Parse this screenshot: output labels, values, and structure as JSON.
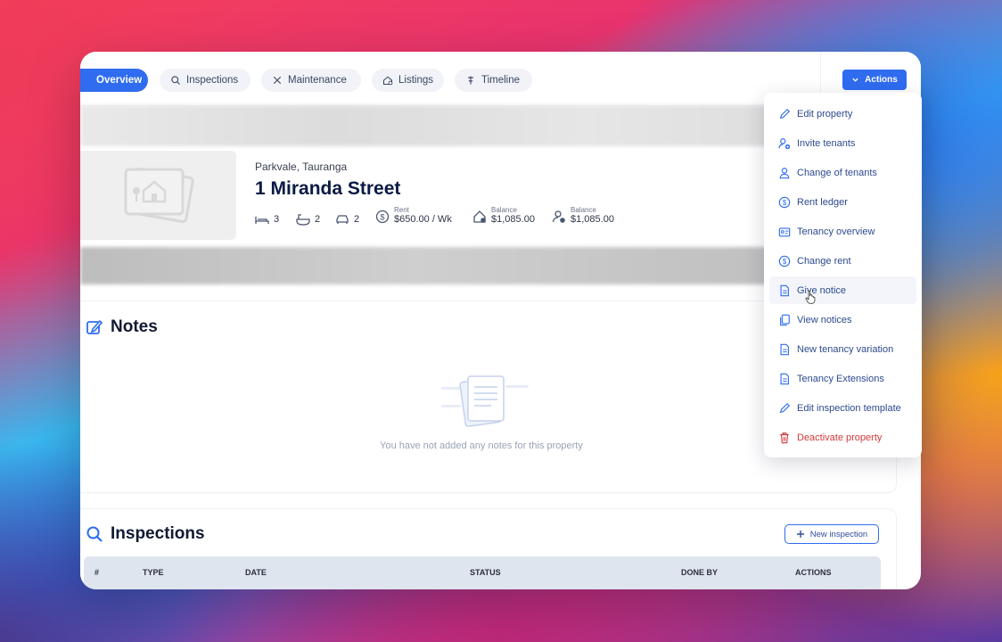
{
  "tabs": [
    {
      "label": "Overview",
      "icon": "home-icon",
      "active": true
    },
    {
      "label": "Inspections",
      "icon": "search-icon"
    },
    {
      "label": "Maintenance",
      "icon": "tools-icon"
    },
    {
      "label": "Listings",
      "icon": "listing-icon"
    },
    {
      "label": "Timeline",
      "icon": "timeline-icon"
    }
  ],
  "actions": {
    "label": "Actions"
  },
  "property": {
    "suburb": "Parkvale, Tauranga",
    "street": "1 Miranda Street",
    "bedrooms": "3",
    "bathrooms": "2",
    "carparks": "2",
    "rent_label": "Rent",
    "rent_value": "$650.00 / Wk",
    "balance1_label": "Balance",
    "balance1_value": "$1,085.00",
    "balance2_label": "Balance",
    "balance2_value": "$1,085.00"
  },
  "notes": {
    "title": "Notes",
    "empty": "You have not added any notes for this property"
  },
  "inspections": {
    "title": "Inspections",
    "new_button": "New inspection",
    "columns": [
      "#",
      "TYPE",
      "DATE",
      "STATUS",
      "DONE BY",
      "ACTIONS"
    ]
  },
  "menu": [
    {
      "label": "Edit property",
      "icon": "pencil-icon"
    },
    {
      "label": "Invite tenants",
      "icon": "user-plus-icon"
    },
    {
      "label": "Change of tenants",
      "icon": "user-icon"
    },
    {
      "label": "Rent ledger",
      "icon": "dollar-icon"
    },
    {
      "label": "Tenancy overview",
      "icon": "id-card-icon"
    },
    {
      "label": "Change rent",
      "icon": "dollar-icon"
    },
    {
      "label": "Give notice",
      "icon": "document-icon",
      "hover": true
    },
    {
      "label": "View notices",
      "icon": "copy-icon"
    },
    {
      "label": "New tenancy variation",
      "icon": "document-icon"
    },
    {
      "label": "Tenancy Extensions",
      "icon": "document-icon"
    },
    {
      "label": "Edit inspection template",
      "icon": "pencil-icon"
    },
    {
      "label": "Deactivate property",
      "icon": "trash-icon",
      "danger": true
    }
  ],
  "colors": {
    "accent": "#2f6cf0",
    "heading": "#0b1a44",
    "danger": "#d23a3a",
    "menu_text": "#2d4a8e"
  }
}
